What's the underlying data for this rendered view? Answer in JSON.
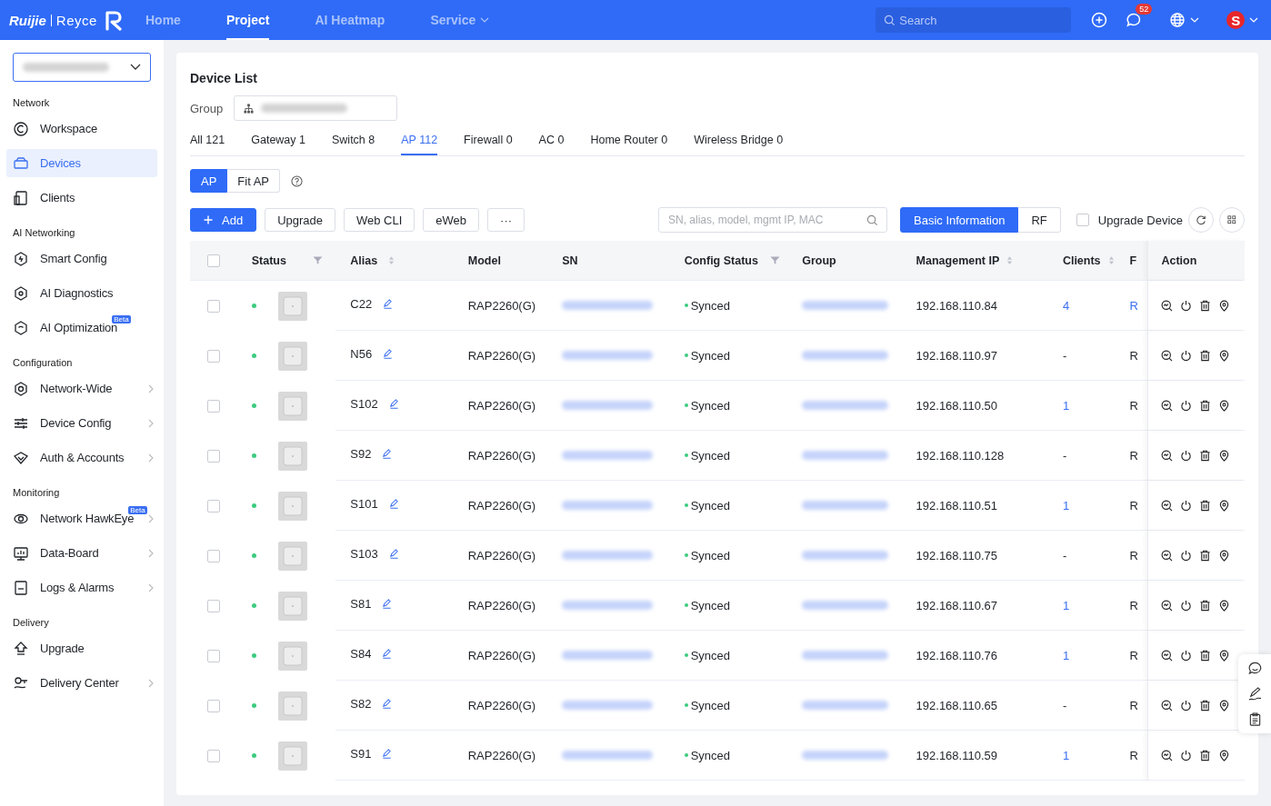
{
  "topbar": {
    "brand": [
      "Ruijie",
      "Reyce"
    ],
    "nav": [
      {
        "label": "Home",
        "selected": false,
        "dropdown": false
      },
      {
        "label": "Project",
        "selected": true,
        "dropdown": false
      },
      {
        "label": "AI Heatmap",
        "selected": false,
        "dropdown": false
      },
      {
        "label": "Service",
        "selected": false,
        "dropdown": true
      }
    ],
    "search": {
      "placeholder": "Search"
    },
    "notifications": "52",
    "avatar": "S"
  },
  "sidebar": {
    "sections": [
      {
        "title": "Network",
        "items": [
          {
            "label": "Workspace",
            "selected": false,
            "expandable": false
          },
          {
            "label": "Devices",
            "selected": true,
            "expandable": false
          },
          {
            "label": "Clients",
            "selected": false,
            "expandable": false
          }
        ]
      },
      {
        "title": "AI Networking",
        "items": [
          {
            "label": "Smart Config",
            "selected": false,
            "expandable": false
          },
          {
            "label": "AI Diagnostics",
            "selected": false,
            "expandable": false
          },
          {
            "label": "AI Optimization",
            "selected": false,
            "expandable": false,
            "badge": "Beta"
          }
        ]
      },
      {
        "title": "Configuration",
        "items": [
          {
            "label": "Network-Wide",
            "selected": false,
            "expandable": true
          },
          {
            "label": "Device Config",
            "selected": false,
            "expandable": true
          },
          {
            "label": "Auth & Accounts",
            "selected": false,
            "expandable": true
          }
        ]
      },
      {
        "title": "Monitoring",
        "items": [
          {
            "label": "Network HawkEye",
            "selected": false,
            "expandable": true,
            "badge": "Beta"
          },
          {
            "label": "Data-Board",
            "selected": false,
            "expandable": true
          },
          {
            "label": "Logs & Alarms",
            "selected": false,
            "expandable": true
          }
        ]
      },
      {
        "title": "Delivery",
        "items": [
          {
            "label": "Upgrade",
            "selected": false,
            "expandable": false
          },
          {
            "label": "Delivery Center",
            "selected": false,
            "expandable": true
          }
        ]
      }
    ]
  },
  "title": "Device List",
  "group_label": "Group",
  "tabs": [
    {
      "label": "All 121",
      "selected": false
    },
    {
      "label": "Gateway 1",
      "selected": false
    },
    {
      "label": "Switch 8",
      "selected": false
    },
    {
      "label": "AP 112",
      "selected": true
    },
    {
      "label": "Firewall 0",
      "selected": false
    },
    {
      "label": "AC 0",
      "selected": false
    },
    {
      "label": "Home Router 0",
      "selected": false
    },
    {
      "label": "Wireless Bridge 0",
      "selected": false
    }
  ],
  "mode": [
    {
      "label": "AP",
      "selected": true
    },
    {
      "label": "Fit AP",
      "selected": false
    }
  ],
  "actions": [
    {
      "label": "Add",
      "kind": "primary"
    },
    {
      "label": "Upgrade",
      "kind": "default"
    },
    {
      "label": "Web CLI",
      "kind": "default"
    },
    {
      "label": "eWeb",
      "kind": "default"
    },
    {
      "label": "···",
      "kind": "default"
    }
  ],
  "filter": {
    "placeholder": "SN, alias, model, mgmt IP, MAC"
  },
  "views": [
    {
      "label": "Basic Information",
      "selected": true
    },
    {
      "label": "RF",
      "selected": false
    }
  ],
  "upgrade_device": {
    "label": "Upgrade Device",
    "checked": false
  },
  "table": {
    "all_selected": false,
    "columns": [
      "Status",
      "Alias",
      "Model",
      "SN",
      "Config Status",
      "Group",
      "Management IP",
      "Clients",
      "F",
      "Action"
    ],
    "rows": [
      {
        "selected": false,
        "online": true,
        "alias": "C22",
        "model": "RAP2260(G)",
        "config": "Synced",
        "ip": "192.168.110.84",
        "clients": "4",
        "clients_link": true,
        "column_10": "R"
      },
      {
        "selected": false,
        "online": true,
        "alias": "N56",
        "model": "RAP2260(G)",
        "config": "Synced",
        "ip": "192.168.110.97",
        "clients": "-",
        "clients_link": false,
        "column_10": "R"
      },
      {
        "selected": false,
        "online": true,
        "alias": "S102",
        "model": "RAP2260(G)",
        "config": "Synced",
        "ip": "192.168.110.50",
        "clients": "1",
        "clients_link": true,
        "column_10": "R"
      },
      {
        "selected": false,
        "online": true,
        "alias": "S92",
        "model": "RAP2260(G)",
        "config": "Synced",
        "ip": "192.168.110.128",
        "clients": "-",
        "clients_link": false,
        "column_10": "R"
      },
      {
        "selected": false,
        "online": true,
        "alias": "S101",
        "model": "RAP2260(G)",
        "config": "Synced",
        "ip": "192.168.110.51",
        "clients": "1",
        "clients_link": true,
        "column_10": "R"
      },
      {
        "selected": false,
        "online": true,
        "alias": "S103",
        "model": "RAP2260(G)",
        "config": "Synced",
        "ip": "192.168.110.75",
        "clients": "-",
        "clients_link": false,
        "column_10": "R"
      },
      {
        "selected": false,
        "online": true,
        "alias": "S81",
        "model": "RAP2260(G)",
        "config": "Synced",
        "ip": "192.168.110.67",
        "clients": "1",
        "clients_link": true,
        "column_10": "R"
      },
      {
        "selected": false,
        "online": true,
        "alias": "S84",
        "model": "RAP2260(G)",
        "config": "Synced",
        "ip": "192.168.110.76",
        "clients": "1",
        "clients_link": true,
        "column_10": "R"
      },
      {
        "selected": false,
        "online": true,
        "alias": "S82",
        "model": "RAP2260(G)",
        "config": "Synced",
        "ip": "192.168.110.65",
        "clients": "-",
        "clients_link": false,
        "column_10": "R"
      },
      {
        "selected": false,
        "online": true,
        "alias": "S91",
        "model": "RAP2260(G)",
        "config": "Synced",
        "ip": "192.168.110.59",
        "clients": "1",
        "clients_link": true,
        "column_10": "R"
      }
    ]
  }
}
